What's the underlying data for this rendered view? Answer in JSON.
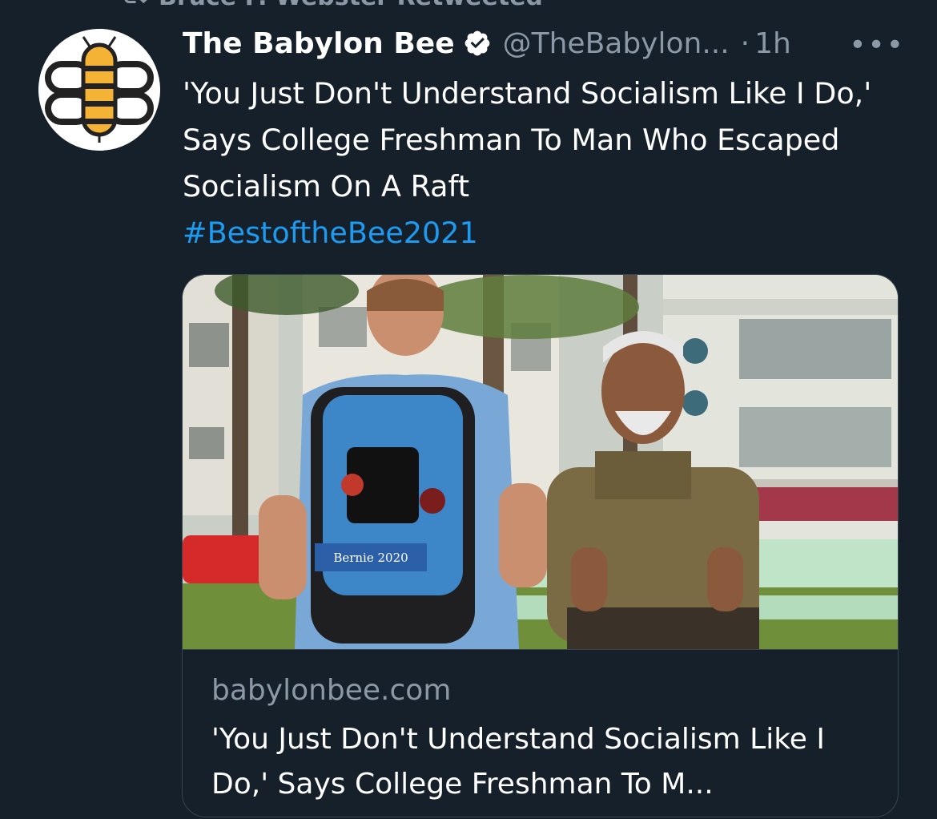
{
  "retweet_context": {
    "label": "Bruce P. Webster Retweeted"
  },
  "tweet": {
    "display_name": "The Babylon Bee",
    "handle": "@TheBabylon...",
    "separator": "·",
    "time": "1h",
    "more": "•••",
    "text": "'You Just Don't Understand Socialism Like I Do,' Says College Freshman To Man Who Escaped Socialism On A Raft",
    "hashtag": "#BestoftheBee2021"
  },
  "card": {
    "patch_text": "Bernie 2020",
    "domain": "babylonbee.com",
    "title": "'You Just Don't Understand Socialism Like I Do,' Says College Freshman To M..."
  },
  "colors": {
    "background": "#15202b",
    "text": "#ffffff",
    "secondary_text": "#8b98a5",
    "link": "#1d9bf0",
    "border": "#38444d",
    "bee_yellow": "#f5b335"
  },
  "icons": [
    "retweet-icon",
    "verified-badge-icon",
    "more-options-icon"
  ]
}
